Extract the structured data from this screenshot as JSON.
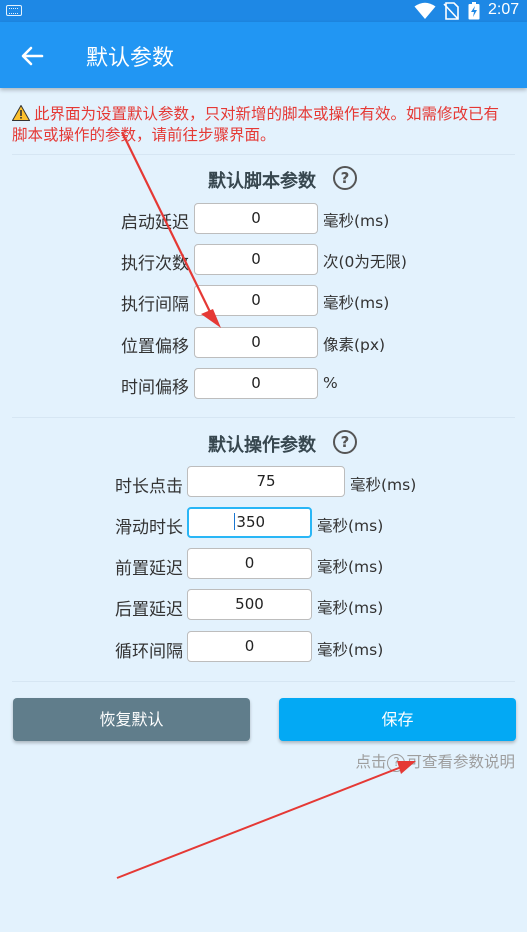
{
  "status_bar": {
    "time": "2:07"
  },
  "toolbar": {
    "title": "默认参数"
  },
  "warning": {
    "text": "此界面为设置默认参数，只对新增的脚本或操作有效。如需修改已有脚本或操作的参数，请前往步骤界面。"
  },
  "script_section": {
    "title": "默认脚本参数",
    "rows": [
      {
        "label": "启动延迟",
        "value": "0",
        "unit": "毫秒(ms)"
      },
      {
        "label": "执行次数",
        "value": "0",
        "unit": "次(0为无限)"
      },
      {
        "label": "执行间隔",
        "value": "0",
        "unit": "毫秒(ms)"
      },
      {
        "label": "位置偏移",
        "value": "0",
        "unit": "像素(px)"
      },
      {
        "label": "时间偏移",
        "value": "0",
        "unit": "%"
      }
    ]
  },
  "action_section": {
    "title": "默认操作参数",
    "rows": [
      {
        "label": "时长点击",
        "value": "75",
        "unit": "毫秒(ms)"
      },
      {
        "label": "滑动时长",
        "value": "350",
        "unit": "毫秒(ms)"
      },
      {
        "label": "前置延迟",
        "value": "0",
        "unit": "毫秒(ms)"
      },
      {
        "label": "后置延迟",
        "value": "500",
        "unit": "毫秒(ms)"
      },
      {
        "label": "循环间隔",
        "value": "0",
        "unit": "毫秒(ms)"
      }
    ]
  },
  "buttons": {
    "restore": "恢复默认",
    "save": "保存"
  },
  "hint": {
    "before": "点击",
    "icon_char": "?",
    "after": "可查看参数说明"
  },
  "colors": {
    "toolbar": "#2196f3",
    "status_bar": "#1e88e5",
    "warning_text": "#e53935",
    "save_button": "#03a9f4",
    "restore_button": "#607d8b",
    "annotation_arrow": "#e53935"
  }
}
